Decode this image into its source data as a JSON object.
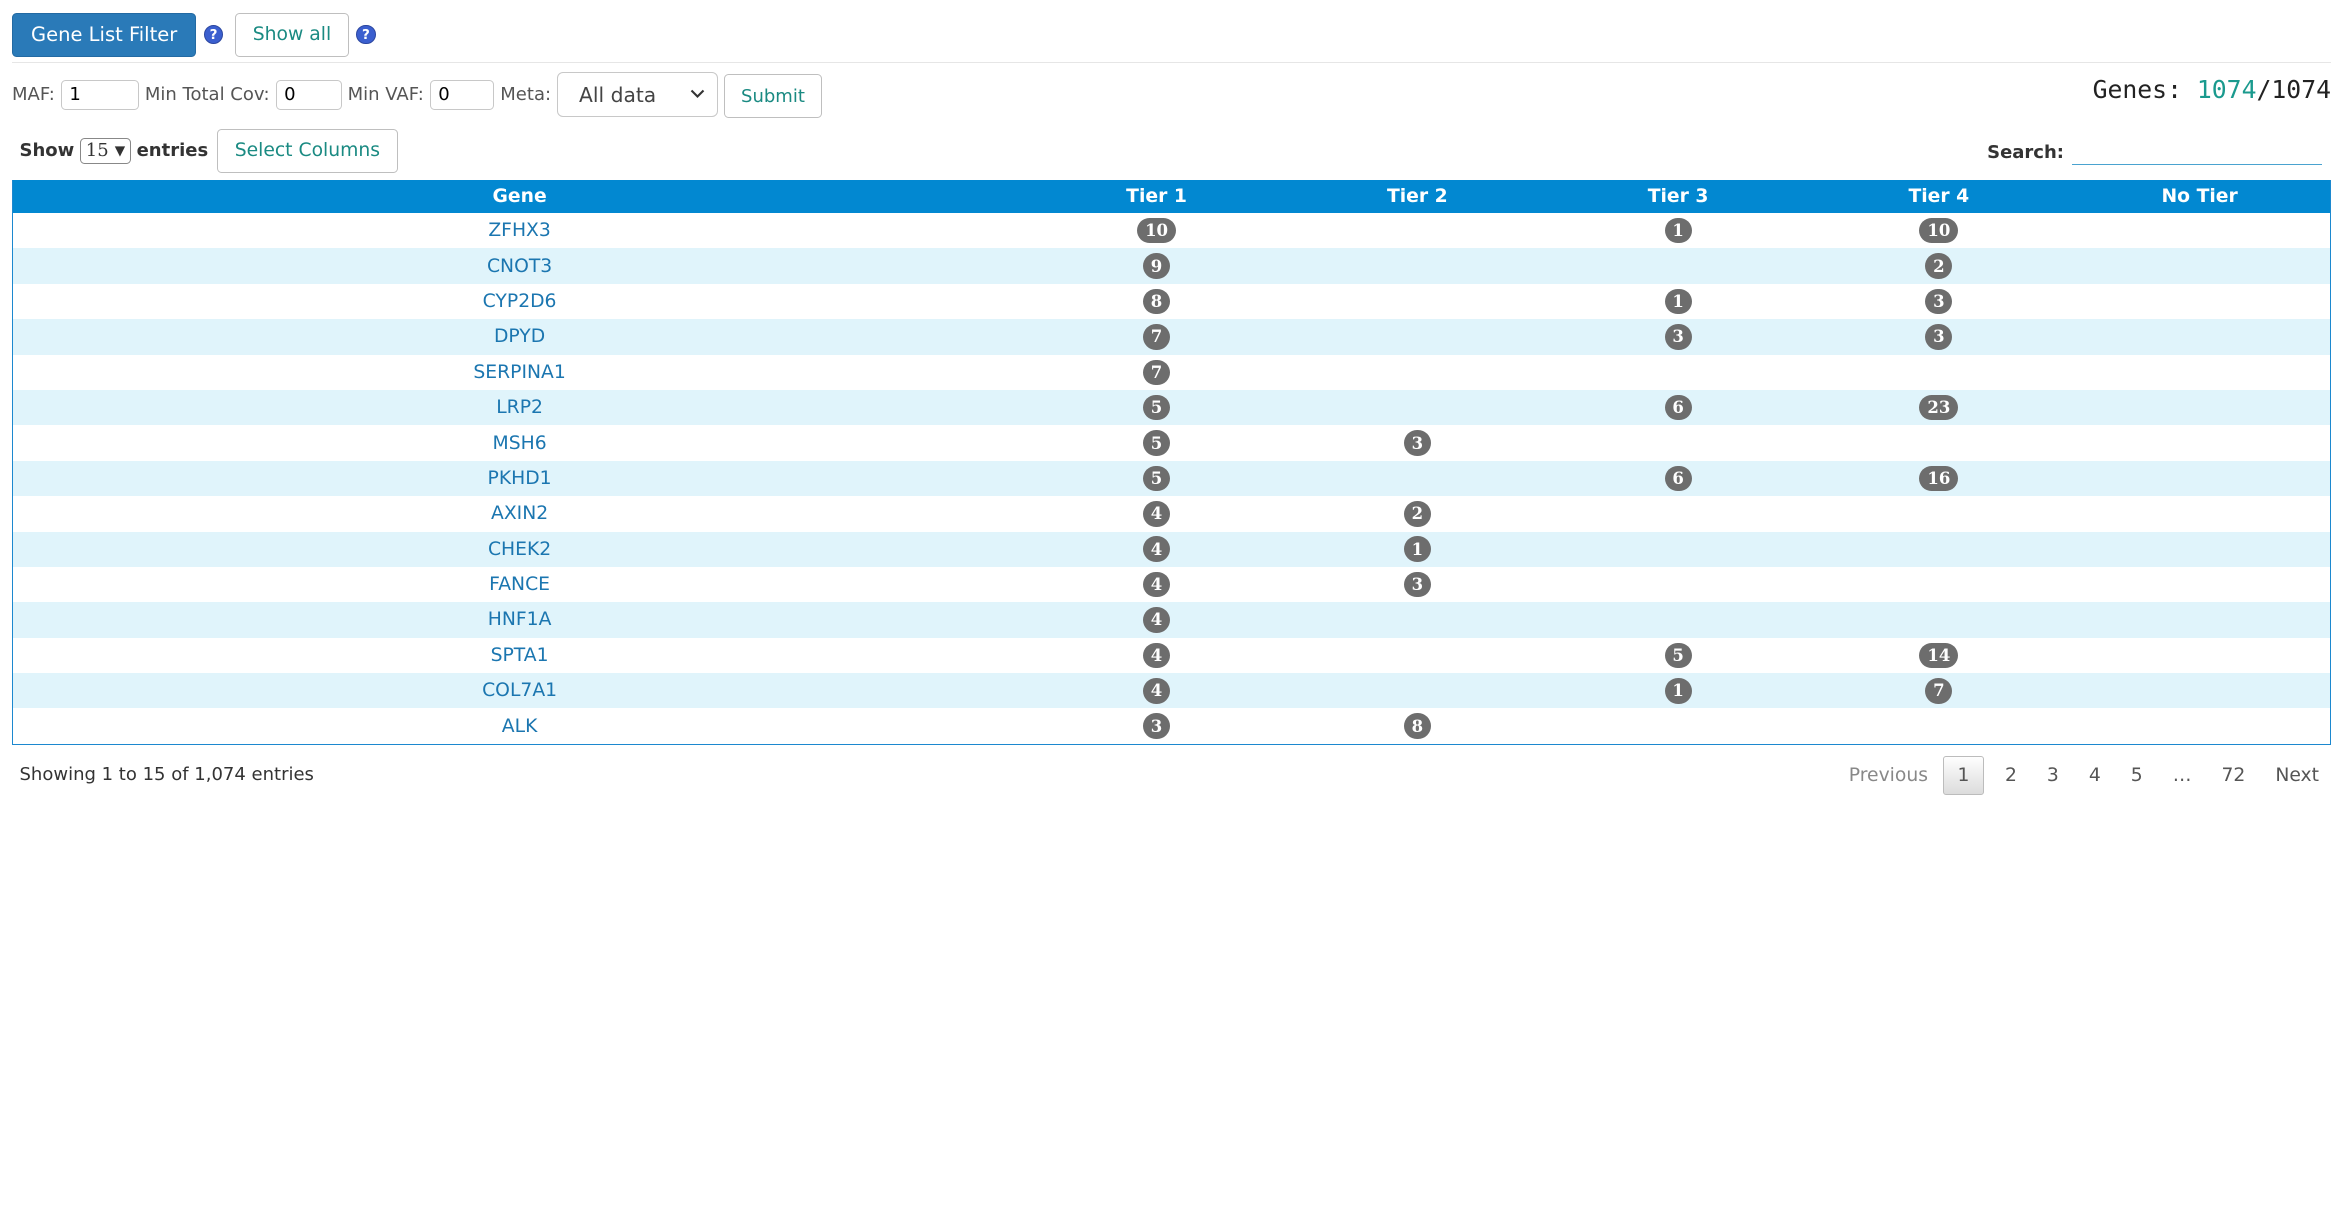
{
  "toolbar": {
    "gene_list_filter": "Gene List Filter",
    "show_all": "Show all",
    "help": "?"
  },
  "filters": {
    "maf_label": "MAF:",
    "maf_value": "1",
    "min_total_cov_label": "Min Total Cov:",
    "min_total_cov_value": "0",
    "min_vaf_label": "Min VAF:",
    "min_vaf_value": "0",
    "meta_label": "Meta:",
    "meta_selected": "All data",
    "submit": "Submit"
  },
  "genes_count": {
    "label": "Genes:",
    "shown": "1074",
    "sep": "/",
    "total": "1074"
  },
  "show_entries": {
    "show": "Show",
    "value": "15",
    "entries": "entries",
    "select_columns": "Select Columns"
  },
  "search": {
    "label": "Search:",
    "value": ""
  },
  "table": {
    "headers": [
      "Gene",
      "Tier 1",
      "Tier 2",
      "Tier 3",
      "Tier 4",
      "No Tier"
    ],
    "rows": [
      {
        "gene": "ZFHX3",
        "t1": "10",
        "t2": "",
        "t3": "1",
        "t4": "10",
        "nt": ""
      },
      {
        "gene": "CNOT3",
        "t1": "9",
        "t2": "",
        "t3": "",
        "t4": "2",
        "nt": ""
      },
      {
        "gene": "CYP2D6",
        "t1": "8",
        "t2": "",
        "t3": "1",
        "t4": "3",
        "nt": ""
      },
      {
        "gene": "DPYD",
        "t1": "7",
        "t2": "",
        "t3": "3",
        "t4": "3",
        "nt": ""
      },
      {
        "gene": "SERPINA1",
        "t1": "7",
        "t2": "",
        "t3": "",
        "t4": "",
        "nt": ""
      },
      {
        "gene": "LRP2",
        "t1": "5",
        "t2": "",
        "t3": "6",
        "t4": "23",
        "nt": ""
      },
      {
        "gene": "MSH6",
        "t1": "5",
        "t2": "3",
        "t3": "",
        "t4": "",
        "nt": ""
      },
      {
        "gene": "PKHD1",
        "t1": "5",
        "t2": "",
        "t3": "6",
        "t4": "16",
        "nt": ""
      },
      {
        "gene": "AXIN2",
        "t1": "4",
        "t2": "2",
        "t3": "",
        "t4": "",
        "nt": ""
      },
      {
        "gene": "CHEK2",
        "t1": "4",
        "t2": "1",
        "t3": "",
        "t4": "",
        "nt": ""
      },
      {
        "gene": "FANCE",
        "t1": "4",
        "t2": "3",
        "t3": "",
        "t4": "",
        "nt": ""
      },
      {
        "gene": "HNF1A",
        "t1": "4",
        "t2": "",
        "t3": "",
        "t4": "",
        "nt": ""
      },
      {
        "gene": "SPTA1",
        "t1": "4",
        "t2": "",
        "t3": "5",
        "t4": "14",
        "nt": ""
      },
      {
        "gene": "COL7A1",
        "t1": "4",
        "t2": "",
        "t3": "1",
        "t4": "7",
        "nt": ""
      },
      {
        "gene": "ALK",
        "t1": "3",
        "t2": "8",
        "t3": "",
        "t4": "",
        "nt": ""
      }
    ]
  },
  "footer": {
    "info": "Showing 1 to 15 of 1,074 entries",
    "previous": "Previous",
    "pages": [
      "1",
      "2",
      "3",
      "4",
      "5",
      "…",
      "72"
    ],
    "next": "Next"
  }
}
